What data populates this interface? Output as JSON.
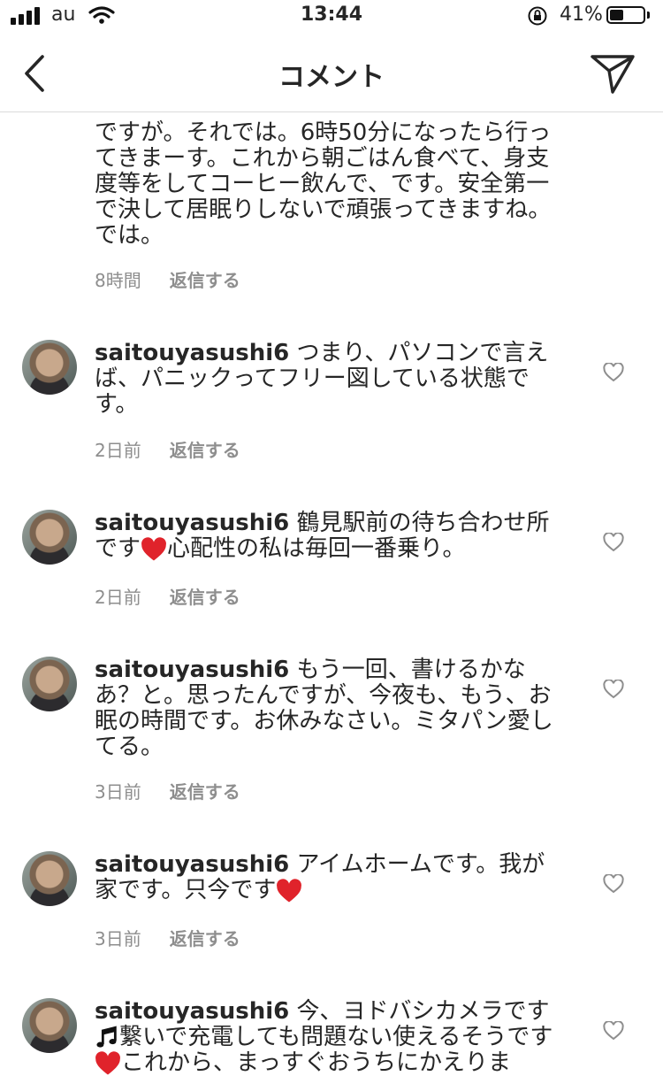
{
  "status_bar": {
    "carrier": "au",
    "time": "13:44",
    "battery_percent_text": "41%",
    "battery_level": 0.41
  },
  "header": {
    "title": "コメント",
    "back_icon": "chevron-left-icon",
    "send_icon": "paper-plane-icon"
  },
  "comments": [
    {
      "username": "",
      "lines": [
        "ですが。それでは。6時50分になったら行っ",
        "てきまーす。これから朝ごはん食べて、身支",
        "度等をしてコーヒー飲んで、です。安全第一",
        "で決して居眠りしないで頑張ってきますね。",
        "では。"
      ],
      "time": "8時間",
      "reply": "返信する"
    },
    {
      "username": "saitouyasushi6",
      "text": "つまり、パソコンで言えば、パニックってフリー図している状態です。",
      "time": "2日前",
      "reply": "返信する"
    },
    {
      "username": "saitouyasushi6",
      "text_a": "鶴見駅前の待ち合わせ所です",
      "text_b": "心配性の私は毎回一番乗り。",
      "time": "2日前",
      "reply": "返信する"
    },
    {
      "username": "saitouyasushi6",
      "text": "もう一回、書けるかなあ？と。思ったんですが、今夜も、もう、お眠の時間です。お休みなさい。ミタパン愛してる。",
      "time": "3日前",
      "reply": "返信する"
    },
    {
      "username": "saitouyasushi6",
      "text": "アイムホームです。我が家です。只今です",
      "time": "3日前",
      "reply": "返信する"
    },
    {
      "username": "saitouyasushi6",
      "text_a": "今、ヨドバシカメラです",
      "text_b": "繋いで充電しても問題ない使えるそうです",
      "text_c": "これから、まっすぐおうちにかえりま",
      "time": "",
      "reply": ""
    }
  ],
  "icons": {
    "like": "heart-outline-icon",
    "heart_emoji": "red-heart-icon",
    "music_emoji": "musical-notes-icon"
  },
  "colors": {
    "text": "#262626",
    "meta": "#8e8e8e",
    "heart_emoji": "#e0232b"
  }
}
